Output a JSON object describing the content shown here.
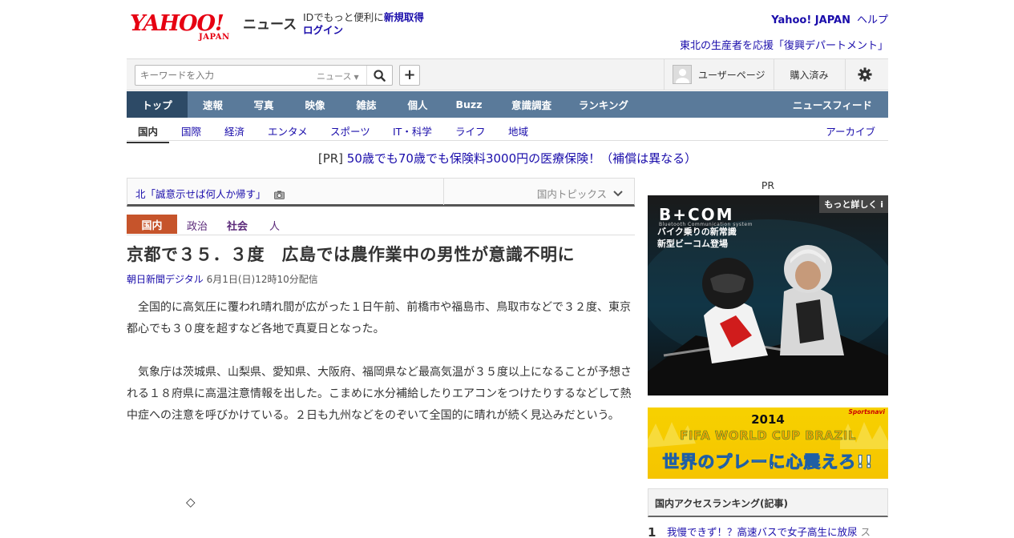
{
  "header": {
    "logo_text": "YAHOO!",
    "logo_sub": "JAPAN",
    "service_name": "ニュース",
    "id_prompt": "IDでもっと便利に",
    "signup": "新規取得",
    "login": "ログイン",
    "yahoo_japan": "Yahoo! JAPAN",
    "help": "ヘルプ",
    "promo": "東北の生産者を応援「復興デパートメント」"
  },
  "search": {
    "placeholder": "キーワードを入力",
    "scope": "ニュース",
    "user_page": "ユーザーページ",
    "purchased": "購入済み"
  },
  "mainnav": [
    "トップ",
    "速報",
    "写真",
    "映像",
    "雑誌",
    "個人",
    "Buzz",
    "意識調査",
    "ランキング"
  ],
  "mainnav_feed": "ニュースフィード",
  "subnav": [
    "国内",
    "国際",
    "経済",
    "エンタメ",
    "スポーツ",
    "IT・科学",
    "ライフ",
    "地域"
  ],
  "subnav_archive": "アーカイブ",
  "pr_line": {
    "tag": "[PR]",
    "text": "50歳でも70歳でも保険料3000円の医療保険！（補償は異なる）"
  },
  "topic": {
    "title": "北「誠意示せば何人か帰す」",
    "right": "国内トピックス"
  },
  "categories": {
    "active": "国内",
    "items": [
      "政治",
      "社会",
      "人"
    ]
  },
  "article": {
    "headline": "京都で３５．３度　広島では農作業中の男性が意識不明に",
    "source": "朝日新聞デジタル",
    "date": "6月1日(日)12時10分配信",
    "paragraphs": [
      "　全国的に高気圧に覆われ晴れ間が広がった１日午前、前橋市や福島市、鳥取市などで３２度、東京都心でも３０度を超すなど各地で真夏日となった。",
      "　気象庁は茨城県、山梨県、愛知県、大阪府、福岡県など最高気温が３５度以上になることが予想される１８府県に高温注意情報を出した。こまめに水分補給したりエアコンをつけたりするなどして熱中症への注意を呼びかけている。２日も九州などをのぞいて全国的に晴れが続く見込みだという。"
    ],
    "diamond": "◇"
  },
  "sidebar": {
    "pr_label": "PR",
    "ad1": {
      "logo": "B+COM",
      "sub": "Bluetooth Communication system",
      "copy_line1": "バイク乗りの新常識",
      "copy_line2": "新型ビーコム登場",
      "more": "もっと詳しく"
    },
    "ad2": {
      "brand": "Sportsnavi",
      "year": "2014",
      "title": "FIFA WORLD CUP BRAZIL",
      "copy": "世界のプレーに心震えろ!!"
    },
    "ranking_title": "国内アクセスランキング(記事)",
    "ranking_first": {
      "num": "1",
      "title": "我慢できず！？高速バスで女子高生に放尿",
      "trail": "ス"
    }
  },
  "colors": {
    "link": "#1a0dab",
    "nav_bg": "#5a7a9a",
    "nav_active": "#2d4a66",
    "category_active": "#c6542b",
    "logo_red": "#e60012"
  }
}
